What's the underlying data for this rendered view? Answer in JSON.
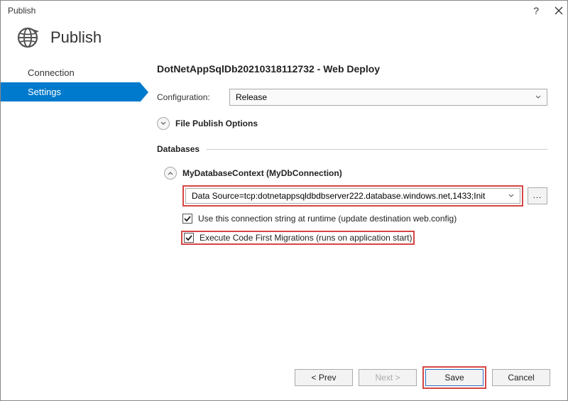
{
  "titlebar": {
    "title": "Publish"
  },
  "header": {
    "title": "Publish"
  },
  "sidebar": {
    "items": [
      {
        "label": "Connection"
      },
      {
        "label": "Settings"
      }
    ]
  },
  "main": {
    "profile_title": "DotNetAppSqlDb20210318112732 - Web Deploy",
    "configuration_label": "Configuration:",
    "configuration_value": "Release",
    "file_publish_options_label": "File Publish Options",
    "databases_label": "Databases",
    "db_context_title": "MyDatabaseContext (MyDbConnection)",
    "connection_string": "Data Source=tcp:dotnetappsqldbdbserver222.database.windows.net,1433;Init",
    "browse_label": "...",
    "checkbox1_label": "Use this connection string at runtime (update destination web.config)",
    "checkbox2_label": "Execute Code First Migrations (runs on application start)"
  },
  "footer": {
    "prev_label": "< Prev",
    "next_label": "Next >",
    "save_label": "Save",
    "cancel_label": "Cancel"
  }
}
